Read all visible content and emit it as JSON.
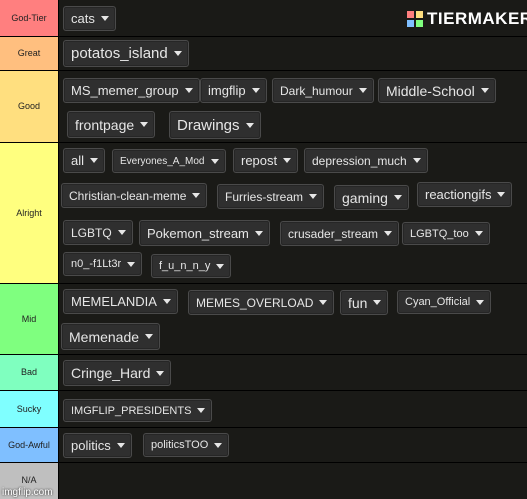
{
  "brand": {
    "logo_text": "TIERMAKER",
    "logo_colors": [
      "#ff7f7f",
      "#ffdf7f",
      "#7fbfff",
      "#7fff7f"
    ]
  },
  "watermark": "imgflip.com",
  "tiers": [
    {
      "label": "God-Tier",
      "color": "#ff7f7f",
      "items": [
        "cats"
      ]
    },
    {
      "label": "Great",
      "color": "#ffbf7f",
      "items": [
        "potatos_island"
      ]
    },
    {
      "label": "Good",
      "color": "#ffdf7f",
      "items": [
        "MS_memer_group",
        "imgflip",
        "Dark_humour",
        "Middle-School",
        "frontpage",
        "Drawings"
      ]
    },
    {
      "label": "Alright",
      "color": "#ffff7f",
      "items": [
        "all",
        "Everyones_A_Mod",
        "repost",
        "depression_much",
        "Christian-clean-meme",
        "Furries-stream",
        "gaming",
        "reactiongifs",
        "LGBTQ",
        "Pokemon_stream",
        "crusader_stream",
        "LGBTQ_too",
        "n0_-f1Lt3r",
        "f_u_n_n_y"
      ]
    },
    {
      "label": "Mid",
      "color": "#7fff7f",
      "items": [
        "MEMELANDIA",
        "MEMES_OVERLOAD",
        "fun",
        "Cyan_Official",
        "Memenade"
      ]
    },
    {
      "label": "Bad",
      "color": "#7fffbf",
      "items": [
        "Cringe_Hard"
      ]
    },
    {
      "label": "Sucky",
      "color": "#7fffff",
      "items": [
        "IMGFLIP_PRESIDENTS"
      ]
    },
    {
      "label": "God-Awful",
      "color": "#7fbfff",
      "items": [
        "politics",
        "politicsTOO"
      ]
    },
    {
      "label": "N/A",
      "color": "#bfbfbf",
      "items": []
    }
  ]
}
